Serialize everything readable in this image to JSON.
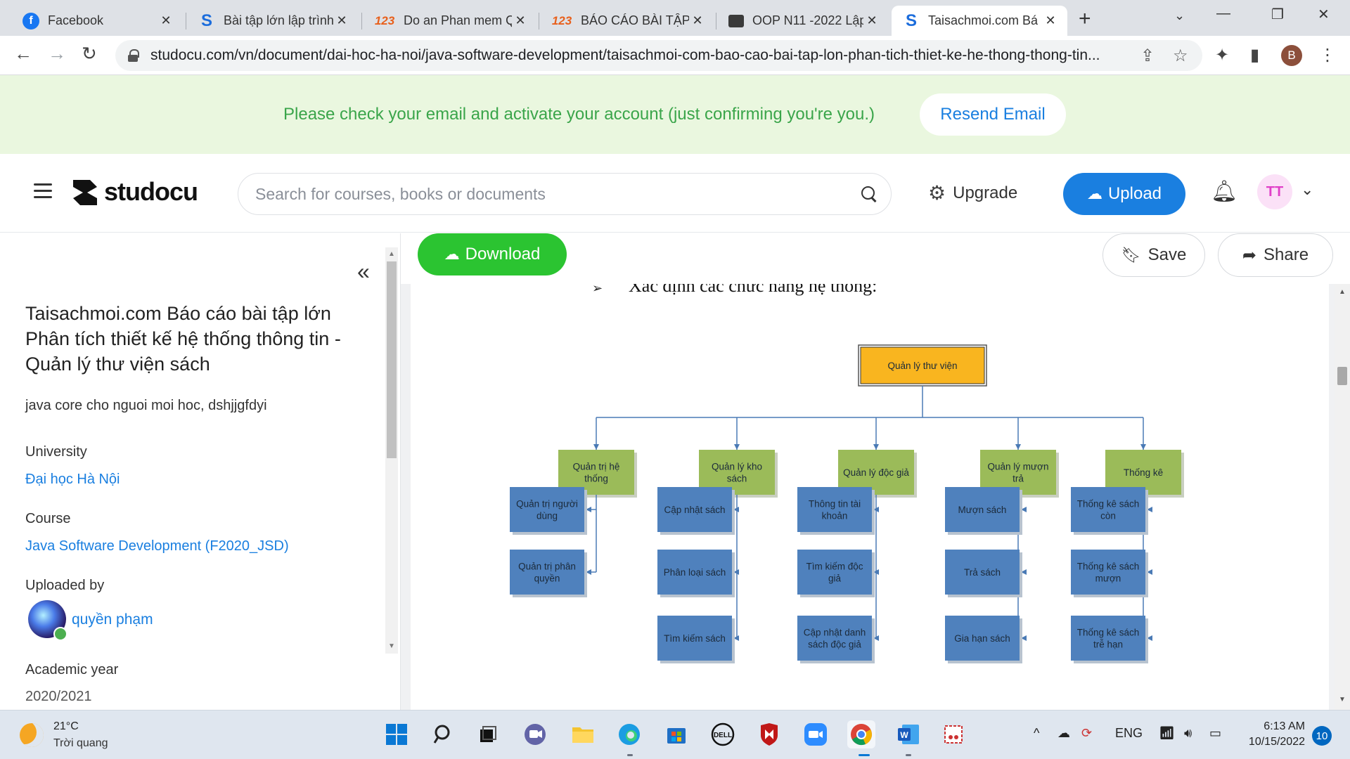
{
  "browser": {
    "tabs": [
      {
        "title": "Facebook",
        "icon": "facebook-icon"
      },
      {
        "title": "Bài tập lớn lập trình",
        "icon": "studocu-icon"
      },
      {
        "title": "Do an Phan mem Q",
        "icon": "123doc-icon"
      },
      {
        "title": "BÁO CÁO BÀI TẬP L",
        "icon": "123doc-icon"
      },
      {
        "title": "OOP N11 -2022 Lập",
        "icon": "classroom-icon"
      },
      {
        "title": "Taisachmoi.com Bá",
        "icon": "studocu-icon",
        "active": true
      }
    ],
    "url": "studocu.com/vn/document/dai-hoc-ha-noi/java-software-development/taisachmoi-com-bao-cao-bai-tap-lon-phan-tich-thiet-ke-he-thong-thong-tin...",
    "profile_initial": "B"
  },
  "banner": {
    "message": "Please check your email and activate your account (just confirming you're you.)",
    "resend_label": "Resend Email"
  },
  "header": {
    "logo_text": "studocu",
    "search_placeholder": "Search for courses, books or documents",
    "upgrade_label": "Upgrade",
    "upload_label": "Upload",
    "avatar_initials": "TT"
  },
  "doc_actions": {
    "download_label": "Download",
    "save_label": "Save",
    "share_label": "Share"
  },
  "sidebar": {
    "title": "Taisachmoi.com Báo cáo bài tập lớn Phân tích thiết kế hệ thống thông tin - Quản lý thư viện sách",
    "description": "java core cho nguoi moi hoc, dshjjgfdyi",
    "university_label": "University",
    "university": "Đại học Hà Nội",
    "course_label": "Course",
    "course": "Java Software Development (F2020_JSD)",
    "uploaded_by_label": "Uploaded by",
    "uploader": "quyền phạm",
    "academic_year_label": "Academic year",
    "academic_year": "2020/2021"
  },
  "document": {
    "heading_line": "Xác định các chức năng hệ thống:",
    "root": "Quản lý thư viện",
    "branches": [
      {
        "label": [
          "Quản trị hệ",
          "thống"
        ],
        "children": [
          [
            "Quản trị người",
            "dùng"
          ],
          [
            "Quản trị phân",
            "quyền"
          ]
        ]
      },
      {
        "label": [
          "Quản lý kho",
          "sách"
        ],
        "children": [
          [
            "Cập nhật sách"
          ],
          [
            "Phân loại sách"
          ],
          [
            "Tìm kiếm sách"
          ]
        ]
      },
      {
        "label": [
          "Quản lý độc giả"
        ],
        "children": [
          [
            "Thông tin tài",
            "khoản"
          ],
          [
            "Tìm kiếm độc",
            "giả"
          ],
          [
            "Cập nhật danh",
            "sách độc giả"
          ]
        ]
      },
      {
        "label": [
          "Quản lý mượn",
          "trả"
        ],
        "children": [
          [
            "Mượn sách"
          ],
          [
            "Trả sách"
          ],
          [
            "Gia hạn sách"
          ]
        ]
      },
      {
        "label": [
          "Thống kê"
        ],
        "children": [
          [
            "Thống kê sách",
            "còn"
          ],
          [
            "Thống kê sách",
            "mượn"
          ],
          [
            "Thống kê sách",
            "trễ hạn"
          ]
        ]
      }
    ],
    "colors": {
      "root": "#f9b51f",
      "branch": "#9bbb59",
      "leaf": "#4f81bd",
      "line": "#4a7ab5"
    }
  },
  "taskbar": {
    "temperature": "21°C",
    "weather": "Trời quang",
    "language": "ENG",
    "time": "6:13 AM",
    "date": "10/15/2022",
    "notifications": "10"
  }
}
